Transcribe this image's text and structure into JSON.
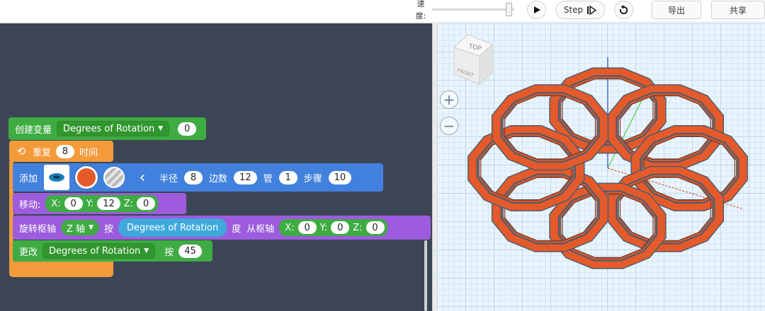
{
  "toolbar": {
    "speed_label": "速度:",
    "speed_value": 0.93,
    "play_icon": "play-icon",
    "step_label": "Step",
    "step_icon": "step-icon",
    "reset_icon": "reset-icon",
    "export_label": "导出",
    "share_label": "共享"
  },
  "blocks": {
    "create_variable": {
      "label": "创建变量",
      "variable": "Degrees of Rotation",
      "value": "0"
    },
    "repeat": {
      "label": "重复",
      "count": "8",
      "suffix": "时间"
    },
    "add": {
      "label": "添加",
      "shape": "torus",
      "color": "#E55A2B",
      "radius_label": "半径",
      "radius": "8",
      "sides_label": "边数",
      "sides": "12",
      "tube_label": "管",
      "tube": "1",
      "steps_label": "步骤",
      "steps": "10"
    },
    "move": {
      "label": "移动:",
      "x_label": "X:",
      "x": "0",
      "y_label": "Y:",
      "y": "12",
      "z_label": "Z:",
      "z": "0"
    },
    "rotate": {
      "label": "旋转枢轴",
      "axis": "Z 轴",
      "by_label": "按",
      "variable": "Degrees of Rotation",
      "unit_label": "度",
      "from_label": "从枢轴",
      "x_label": "X:",
      "x": "0",
      "y_label": "Y:",
      "y": "0",
      "z_label": "Z:",
      "z": "0"
    },
    "change": {
      "label": "更改",
      "variable": "Degrees of Rotation",
      "by_label": "按",
      "value": "45"
    }
  },
  "viewport": {
    "cube_top_label": "TOP",
    "cube_front_label": "FRONT",
    "zoom_in_icon": "plus-icon",
    "zoom_out_icon": "minus-icon",
    "shape_color": "#E55A2B",
    "outline_color": "#4F5D6C"
  }
}
